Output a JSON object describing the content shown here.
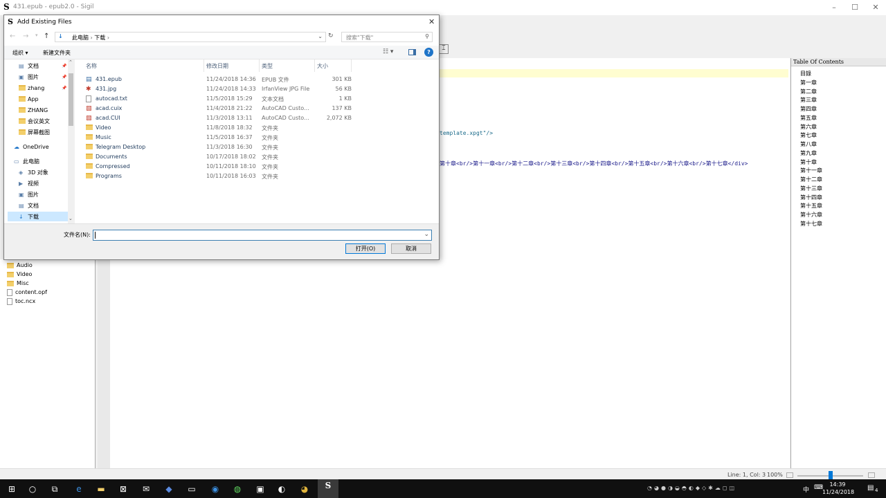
{
  "app": {
    "title": "431.epub - epub2.0 - Sigil",
    "logo": "S"
  },
  "editor": {
    "line_template": "template.xpgt\"/>",
    "line_toc": "第十章<br/>第十一章<br/>第十二章<br/>第十三章<br/>第十四章<br/>第十五章<br/>第十六章<br/>第十七章</div>"
  },
  "book_browser": {
    "items": [
      "Audio",
      "Video",
      "Misc",
      "content.opf",
      "toc.ncx"
    ]
  },
  "toc": {
    "title": "Table Of Contents",
    "items": [
      "目錄",
      "第一章",
      "第二章",
      "第三章",
      "第四章",
      "第五章",
      "第六章",
      "第七章",
      "第八章",
      "第九章",
      "第十章",
      "第十一章",
      "第十二章",
      "第十三章",
      "第十四章",
      "第十五章",
      "第十六章",
      "第十七章"
    ]
  },
  "status": {
    "position": "Line: 1, Col: 3",
    "zoom": "100%"
  },
  "dialog": {
    "title": "Add Existing Files",
    "breadcrumb": [
      "此电脑",
      "下载"
    ],
    "search_placeholder": "搜索\"下载\"",
    "organize_label": "组织 ▾",
    "new_folder_label": "新建文件夹",
    "nav": [
      "文档",
      "图片",
      "zhang",
      "App",
      "ZHANG",
      "会议英文",
      "屏幕截图",
      "OneDrive",
      "此电脑",
      "3D 对象",
      "视频",
      "图片",
      "文档",
      "下载"
    ],
    "columns": [
      "名称",
      "修改日期",
      "类型",
      "大小"
    ],
    "files": [
      {
        "name": "431.epub",
        "date": "11/24/2018 14:36",
        "type": "EPUB 文件",
        "size": "301 KB",
        "icon": "epub-icon"
      },
      {
        "name": "431.jpg",
        "date": "11/24/2018 14:33",
        "type": "IrfanView JPG File",
        "size": "56 KB",
        "icon": "image-icon"
      },
      {
        "name": "autocad.txt",
        "date": "11/5/2018 15:29",
        "type": "文本文档",
        "size": "1 KB",
        "icon": "text-file-icon"
      },
      {
        "name": "acad.cuix",
        "date": "11/4/2018 21:22",
        "type": "AutoCAD Custo...",
        "size": "137 KB",
        "icon": "autocad-icon"
      },
      {
        "name": "acad.CUI",
        "date": "11/3/2018 13:11",
        "type": "AutoCAD Custo...",
        "size": "2,072 KB",
        "icon": "autocad-icon"
      },
      {
        "name": "Video",
        "date": "11/8/2018 18:32",
        "type": "文件夹",
        "size": "",
        "icon": "folder-icon"
      },
      {
        "name": "Music",
        "date": "11/5/2018 16:37",
        "type": "文件夹",
        "size": "",
        "icon": "folder-icon"
      },
      {
        "name": "Telegram Desktop",
        "date": "11/3/2018 16:30",
        "type": "文件夹",
        "size": "",
        "icon": "folder-icon"
      },
      {
        "name": "Documents",
        "date": "10/17/2018 18:02",
        "type": "文件夹",
        "size": "",
        "icon": "folder-icon"
      },
      {
        "name": "Compressed",
        "date": "10/11/2018 18:10",
        "type": "文件夹",
        "size": "",
        "icon": "folder-icon"
      },
      {
        "name": "Programs",
        "date": "10/11/2018 16:03",
        "type": "文件夹",
        "size": "",
        "icon": "folder-icon"
      }
    ],
    "filename_label": "文件名(N):",
    "filename_value": "",
    "open_label": "打开(O)",
    "cancel_label": "取消"
  },
  "taskbar": {
    "time": "14:39",
    "date": "11/24/2018",
    "ime": "中",
    "notification_count": "4"
  }
}
